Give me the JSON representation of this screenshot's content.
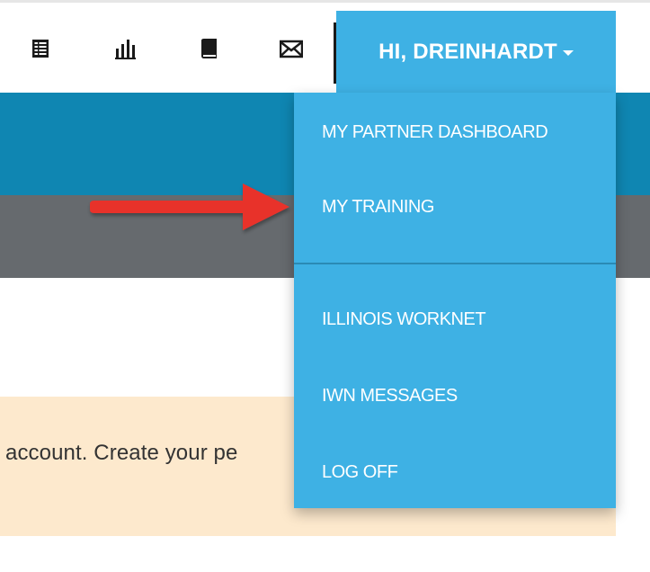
{
  "toolbar": {
    "icons": [
      "list-icon",
      "bar-chart-icon",
      "book-icon",
      "envelope-icon"
    ]
  },
  "user_menu": {
    "greeting": "HI, DREINHARDT",
    "items": [
      {
        "label": "MY PARTNER DASHBOARD"
      },
      {
        "label": "MY TRAINING"
      },
      {
        "label": "ILLINOIS WORKNET"
      },
      {
        "label": "IWN MESSAGES"
      },
      {
        "label": "LOG OFF"
      }
    ]
  },
  "notice": {
    "text": "account. Create your pe"
  },
  "colors": {
    "menu_bg": "#3eb1e4",
    "header_band": "#0f86b2",
    "sub_band": "#666a6e",
    "notice_bg": "#fde9cd",
    "arrow": "#e8302c"
  }
}
